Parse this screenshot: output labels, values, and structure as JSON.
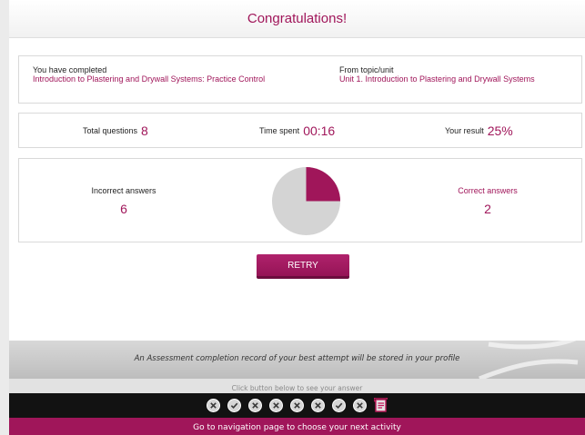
{
  "header": {
    "title": "Congratulations!"
  },
  "completion": {
    "completed_label": "You have completed",
    "activity_name": "Introduction to Plastering and Drywall Systems: Practice Control",
    "topic_label": "From topic/unit",
    "topic_name": "Unit 1. Introduction to Plastering and Drywall Systems"
  },
  "stats": {
    "total_label": "Total questions",
    "total_value": "8",
    "time_label": "Time spent",
    "time_value": "00:16",
    "result_label": "Your result",
    "result_value": "25%"
  },
  "results": {
    "incorrect_label": "Incorrect answers",
    "incorrect_value": "6",
    "correct_label": "Correct answers",
    "correct_value": "2",
    "correct_fraction": 0.25,
    "pie_colors": {
      "correct": "#a0165a",
      "incorrect": "#d4d4d4"
    }
  },
  "actions": {
    "retry_label": "RETRY"
  },
  "footer": {
    "note": "An Assessment completion record of your best attempt will be stored in your profile",
    "hint": "Click button below to see your answer",
    "answers": [
      "incorrect",
      "correct",
      "incorrect",
      "incorrect",
      "incorrect",
      "incorrect",
      "correct",
      "incorrect"
    ],
    "summary_icon": "scroll-icon",
    "nav_label": "Go to navigation page to choose your next activity"
  },
  "colors": {
    "accent": "#a0165a",
    "footer_dark": "#121212"
  }
}
